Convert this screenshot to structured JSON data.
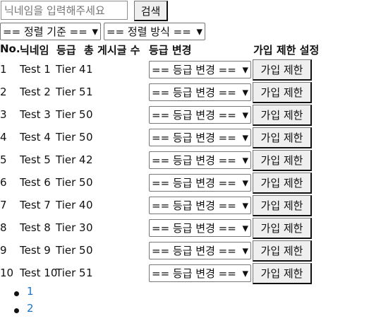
{
  "search": {
    "placeholder": "닉네임을 입력해주세요",
    "button_label": "검색"
  },
  "filters": {
    "sort_key": "== 정렬 기준 ==",
    "sort_order": "== 정렬 방식 =="
  },
  "table": {
    "headers": [
      "No.",
      "닉네임",
      "등급",
      "총 게시글 수",
      "등급 변경",
      "가입 제한 설정"
    ],
    "rows": [
      {
        "no": "1",
        "nickname": "Test 1",
        "tier": "Tier 4",
        "posts": "1",
        "grade_select": "== 등급 변경 ==",
        "action": "가입 제한"
      },
      {
        "no": "2",
        "nickname": "Test 2",
        "tier": "Tier 5",
        "posts": "1",
        "grade_select": "== 등급 변경 ==",
        "action": "가입 제한"
      },
      {
        "no": "3",
        "nickname": "Test 3",
        "tier": "Tier 5",
        "posts": "0",
        "grade_select": "== 등급 변경 ==",
        "action": "가입 제한"
      },
      {
        "no": "4",
        "nickname": "Test 4",
        "tier": "Tier 5",
        "posts": "0",
        "grade_select": "== 등급 변경 ==",
        "action": "가입 제한"
      },
      {
        "no": "5",
        "nickname": "Test 5",
        "tier": "Tier 4",
        "posts": "2",
        "grade_select": "== 등급 변경 ==",
        "action": "가입 제한"
      },
      {
        "no": "6",
        "nickname": "Test 6",
        "tier": "Tier 5",
        "posts": "0",
        "grade_select": "== 등급 변경 ==",
        "action": "가입 제한"
      },
      {
        "no": "7",
        "nickname": "Test 7",
        "tier": "Tier 4",
        "posts": "0",
        "grade_select": "== 등급 변경 ==",
        "action": "가입 제한"
      },
      {
        "no": "8",
        "nickname": "Test 8",
        "tier": "Tier 3",
        "posts": "0",
        "grade_select": "== 등급 변경 ==",
        "action": "가입 제한"
      },
      {
        "no": "9",
        "nickname": "Test 9",
        "tier": "Tier 5",
        "posts": "0",
        "grade_select": "== 등급 변경 ==",
        "action": "가입 제한"
      },
      {
        "no": "10",
        "nickname": "Test 10",
        "tier": "Tier 5",
        "posts": "1",
        "grade_select": "== 등급 변경 ==",
        "action": "가입 제한"
      }
    ]
  },
  "pagination": [
    "1",
    "2"
  ],
  "colors": {
    "link": "#1a73c7",
    "button_bg": "#efefef"
  }
}
